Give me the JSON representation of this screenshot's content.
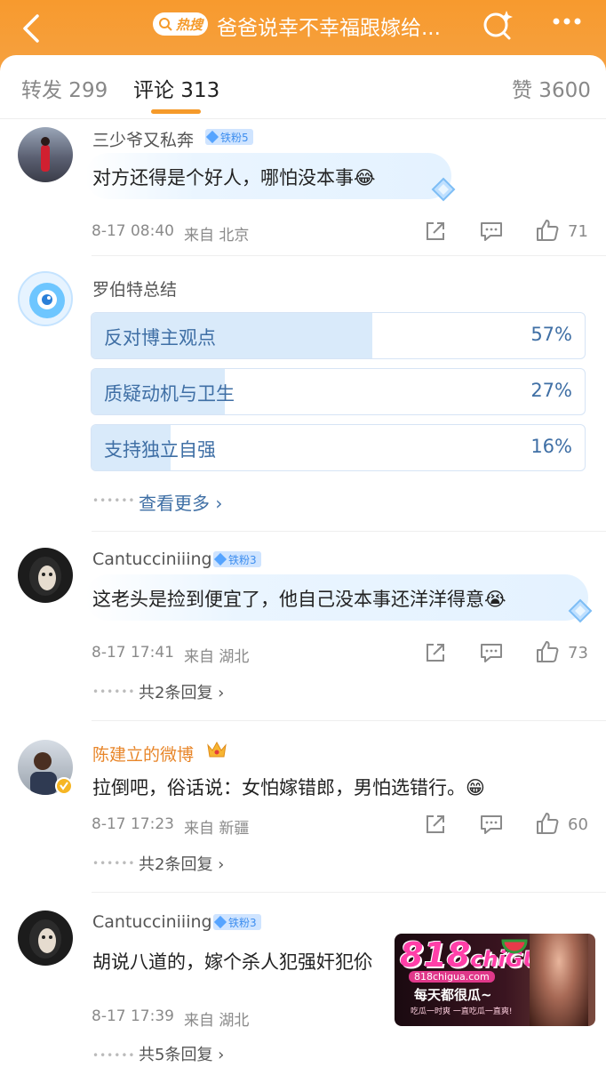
{
  "header": {
    "hot_label": "热搜",
    "topic_title": "爸爸说幸不幸福跟嫁给..."
  },
  "tabs": {
    "repost": "转发 299",
    "comments": "评论 313",
    "likes": "赞 3600"
  },
  "comments": [
    {
      "name": "三少爷又私奔",
      "badge": "铁粉5",
      "text": "对方还得是个好人，哪怕没本事😂",
      "time": "8-17 08:40",
      "from": "来自 北京",
      "likes": "71"
    },
    {
      "name": "罗伯特总结",
      "poll": [
        {
          "label": "反对博主观点",
          "pct": "57%",
          "value": 57
        },
        {
          "label": "质疑动机与卫生",
          "pct": "27%",
          "value": 27
        },
        {
          "label": "支持独立自强",
          "pct": "16%",
          "value": 16
        }
      ],
      "see_more": "查看更多 ›"
    },
    {
      "name": "Cantucciniiing",
      "badge": "铁粉3",
      "text": "这老头是捡到便宜了，他自己没本事还洋洋得意😭",
      "time": "8-17 17:41",
      "from": "来自 湖北",
      "likes": "73",
      "replies": "共2条回复 ›"
    },
    {
      "name": "陈建立的微博",
      "text": "拉倒吧，俗话说：女怕嫁错郎，男怕选错行。😁",
      "time": "8-17 17:23",
      "from": "来自 新疆",
      "likes": "60",
      "replies": "共2条回复 ›"
    },
    {
      "name": "Cantucciniiing",
      "badge": "铁粉3",
      "text": "胡说八道的，嫁个杀人犯强奸犯伱",
      "time": "8-17 17:39",
      "from": "来自 湖北",
      "replies": "共5条回复 ›"
    }
  ],
  "ad": {
    "logo": "818",
    "logo_suffix": "chiGUA",
    "url": "818chigua.com",
    "slogan": "每天都很瓜~",
    "sub": "吃瓜一时爽 一直吃瓜一直爽!"
  },
  "colors": {
    "header_orange": "#f79a2e",
    "accent_orange": "#f59a2a",
    "poll_blue": "#3f6fa5",
    "fan_badge": "#3e8eef"
  }
}
